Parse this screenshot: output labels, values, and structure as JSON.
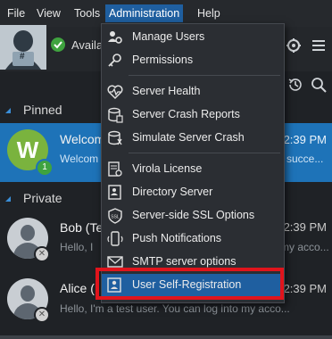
{
  "menubar": {
    "items": [
      "File",
      "View",
      "Tools",
      "Administration",
      "Help"
    ],
    "active": "Administration"
  },
  "header": {
    "status_text": "Availa",
    "avatar_symbol": "#"
  },
  "sections": {
    "pinned_label": "Pinned",
    "private_label": "Private"
  },
  "pinned_chat": {
    "avatar_letter": "W",
    "unread": "1",
    "name": "Welcom",
    "preview": "Welcom",
    "preview_tail": "succe...",
    "time": "2:39 PM"
  },
  "private_chats": [
    {
      "name": "Bob (Te",
      "preview": "Hello, I",
      "preview_tail": "my acco...",
      "time": "2:39 PM"
    },
    {
      "name": "Alice (",
      "preview": "Hello, I'm a test user. You can log into my acco...",
      "time": "2:39 PM"
    }
  ],
  "dropdown": {
    "items": [
      {
        "label": "Manage Users",
        "icon": "users-gear-icon"
      },
      {
        "label": "Permissions",
        "icon": "key-icon"
      },
      {
        "label": "Server Health",
        "icon": "heart-pulse-icon"
      },
      {
        "label": "Server Crash Reports",
        "icon": "database-report-icon"
      },
      {
        "label": "Simulate Server Crash",
        "icon": "database-crash-icon"
      },
      {
        "label": "Virola License",
        "icon": "license-icon"
      },
      {
        "label": "Directory Server",
        "icon": "directory-icon"
      },
      {
        "label": "Server-side SSL Options",
        "icon": "ssl-icon"
      },
      {
        "label": "Push Notifications",
        "icon": "push-icon"
      },
      {
        "label": "SMTP server options",
        "icon": "smtp-icon"
      },
      {
        "label": "User Self-Registration",
        "icon": "self-registration-icon"
      }
    ],
    "selected": "User Self-Registration"
  },
  "colors": {
    "accent": "#1f5fa0",
    "pinned_bg": "#1e73b8",
    "highlight": "#e0141c",
    "online": "#3fa33f"
  }
}
